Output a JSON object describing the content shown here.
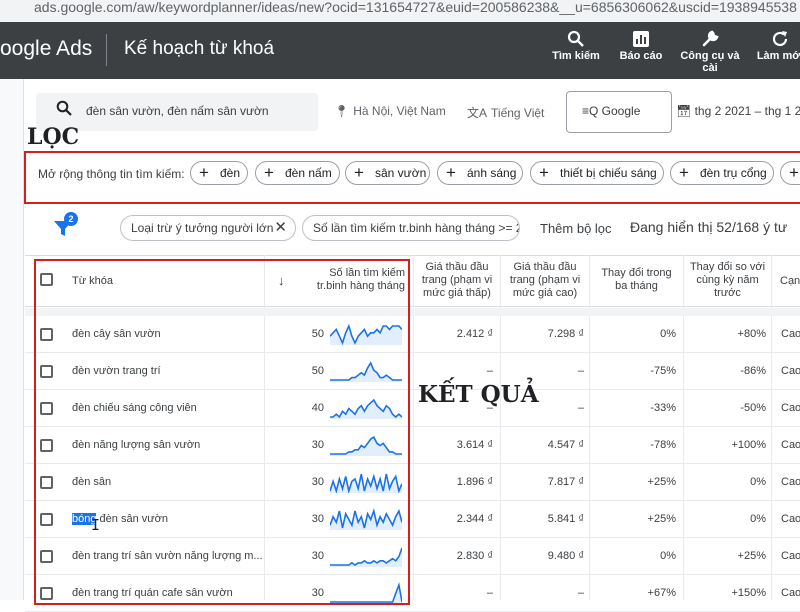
{
  "browser": {
    "url": "ads.google.com/aw/keywordplanner/ideas/new?ocid=131654727&euid=200586238&__u=6856306062&uscid=1938945538"
  },
  "header": {
    "brand": "oogle Ads",
    "title": "Kế hoạch từ khoá",
    "tools": [
      {
        "label": "Tìm kiếm",
        "icon": "search-icon"
      },
      {
        "label": "Báo cáo",
        "icon": "report-icon"
      },
      {
        "label": "Công cụ và cài",
        "icon": "wrench-icon"
      },
      {
        "label": "Làm mới",
        "icon": "refresh-icon"
      }
    ]
  },
  "search": {
    "query": "đèn sân vườn, đèn nấm sân vườn"
  },
  "location": "Hà Nội, Việt Nam",
  "language": "Tiếng Việt",
  "network": "Google",
  "daterange": "thg 2 2021 – thg 1 20",
  "annotations": {
    "filter": "LỌC",
    "result": "KẾT QUẢ"
  },
  "expand": {
    "label": "Mở rộng thông tin tìm kiếm:",
    "chips": [
      "đèn",
      "đèn nấm",
      "sân vườn",
      "ánh sáng",
      "thiết bị chiếu sáng",
      "đèn trụ cổng",
      ""
    ]
  },
  "filters": {
    "badge": "2",
    "chip1": "Loại trừ ý tưởng người lớn",
    "chip2": "Số lần tìm kiếm tr.binh hàng tháng >= 2",
    "add": "Thêm bộ lọc",
    "showing": "Đang hiển thị 52/168 ý tư"
  },
  "table": {
    "headers": {
      "keyword": "Từ khóa",
      "searches": [
        "Số lần tìm kiếm",
        "tr.binh hàng tháng"
      ],
      "bid_low": [
        "Giá thầu đầu",
        "trang (phạm vi",
        "mức giá thấp)"
      ],
      "bid_high": [
        "Giá thầu đầu",
        "trang (phạm vi",
        "mức giá cao)"
      ],
      "change_3m": [
        "Thay đổi trong",
        "ba tháng"
      ],
      "change_yoy": [
        "Thay đổi so với",
        "cùng kỳ năm",
        "trước"
      ],
      "comp": "Cạn"
    },
    "rows": [
      {
        "kw_pre": "",
        "kw_main": "đèn cây sân vườn",
        "searches": "50",
        "bid_low": "2.412 ₫",
        "bid_high": "7.298 ₫",
        "change_3m": "0%",
        "change_yoy": "+80%",
        "comp": "Cao",
        "trend": [
          5,
          6,
          7,
          5,
          3,
          6,
          8,
          5,
          3,
          5,
          6,
          7,
          5,
          6,
          6,
          7,
          6,
          8,
          8,
          7,
          8,
          8,
          8,
          7
        ]
      },
      {
        "kw_pre": "",
        "kw_main": "đèn vườn trang trí",
        "searches": "50",
        "bid_low": "–",
        "bid_high": "–",
        "change_3m": "-75%",
        "change_yoy": "-86%",
        "comp": "Cao",
        "trend": [
          1,
          1,
          1,
          1,
          1,
          1,
          1,
          2,
          2,
          3,
          4,
          3,
          6,
          8,
          5,
          4,
          2,
          2,
          3,
          2,
          1,
          1,
          1,
          1
        ]
      },
      {
        "kw_pre": "",
        "kw_main": "đèn chiếu sáng công viên",
        "searches": "40",
        "bid_low": "–",
        "bid_high": "–",
        "change_3m": "-33%",
        "change_yoy": "-50%",
        "comp": "Cao",
        "trend": [
          2,
          2,
          3,
          2,
          4,
          3,
          5,
          4,
          3,
          5,
          6,
          4,
          6,
          7,
          8,
          6,
          5,
          4,
          6,
          5,
          3,
          2,
          3,
          2
        ]
      },
      {
        "kw_pre": "",
        "kw_main": "đèn năng lượng sân vườn",
        "searches": "30",
        "bid_low": "3.614 ₫",
        "bid_high": "4.547 ₫",
        "change_3m": "-78%",
        "change_yoy": "+100%",
        "comp": "Cao",
        "trend": [
          1,
          1,
          1,
          1,
          1,
          1,
          2,
          2,
          3,
          3,
          5,
          4,
          6,
          8,
          9,
          6,
          5,
          6,
          4,
          2,
          2,
          1,
          1,
          1
        ]
      },
      {
        "kw_pre": "",
        "kw_main": "đèn sân",
        "searches": "30",
        "bid_low": "1.896 ₫",
        "bid_high": "7.817 ₫",
        "change_3m": "+25%",
        "change_yoy": "0%",
        "comp": "Cao",
        "trend": [
          2,
          6,
          2,
          7,
          3,
          8,
          2,
          6,
          7,
          3,
          9,
          2,
          7,
          4,
          8,
          3,
          7,
          2,
          9,
          3,
          6,
          8,
          2,
          5
        ]
      },
      {
        "kw_pre": "bóng",
        "kw_main": " đèn sân vườn",
        "searches": "30",
        "bid_low": "2.344 ₫",
        "bid_high": "5.841 ₫",
        "change_3m": "+25%",
        "change_yoy": "0%",
        "comp": "Cao",
        "trend": [
          3,
          6,
          4,
          8,
          2,
          7,
          5,
          3,
          8,
          4,
          6,
          2,
          7,
          5,
          8,
          3,
          6,
          4,
          7,
          5,
          3,
          6,
          8,
          4
        ]
      },
      {
        "kw_pre": "",
        "kw_main": "đèn trang trí sân vườn năng lượng m...",
        "searches": "30",
        "bid_low": "2.830 ₫",
        "bid_high": "9.480 ₫",
        "change_3m": "0%",
        "change_yoy": "+25%",
        "comp": "Cao",
        "trend": [
          1,
          1,
          1,
          1,
          1,
          1,
          1,
          2,
          1,
          2,
          2,
          3,
          2,
          2,
          3,
          2,
          3,
          3,
          2,
          3,
          4,
          3,
          5,
          9
        ]
      },
      {
        "kw_pre": "",
        "kw_main": "đèn trang trí quán cafe sân vườn",
        "searches": "30",
        "bid_low": "–",
        "bid_high": "–",
        "change_3m": "+67%",
        "change_yoy": "+150%",
        "comp": "Cao",
        "trend": [
          1,
          1,
          1,
          1,
          1,
          1,
          1,
          1,
          1,
          1,
          1,
          1,
          1,
          1,
          1,
          1,
          1,
          1,
          1,
          1,
          1,
          2,
          3,
          1
        ]
      }
    ]
  }
}
